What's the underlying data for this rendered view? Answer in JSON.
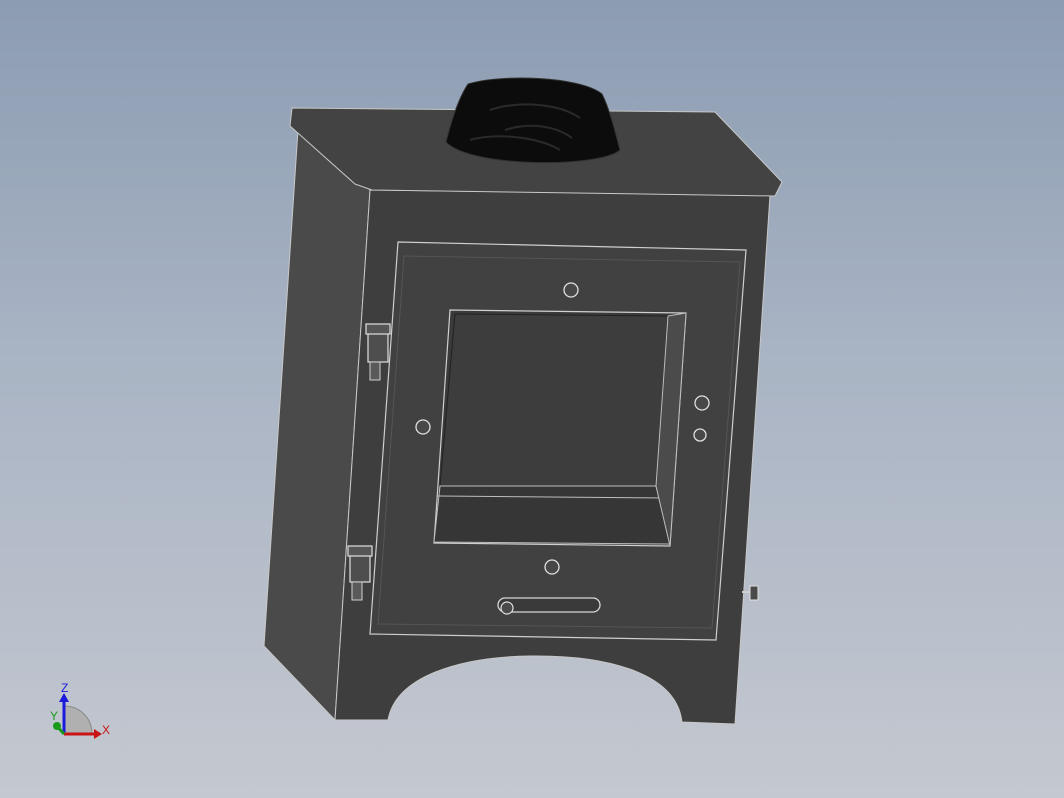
{
  "triad": {
    "z_label": "Z",
    "y_label": "Y",
    "x_label": "X",
    "z_color": "#1a1adc",
    "y_color": "#1a9a1a",
    "x_color": "#c81414"
  },
  "colors": {
    "background_top": "#8c9cb2",
    "background_bottom": "#c4c8d0",
    "body_dark": "#3e3e3e",
    "body_side": "#4a4a4a",
    "flue": "#0c0c0c",
    "edge": "#bfbfbf"
  }
}
